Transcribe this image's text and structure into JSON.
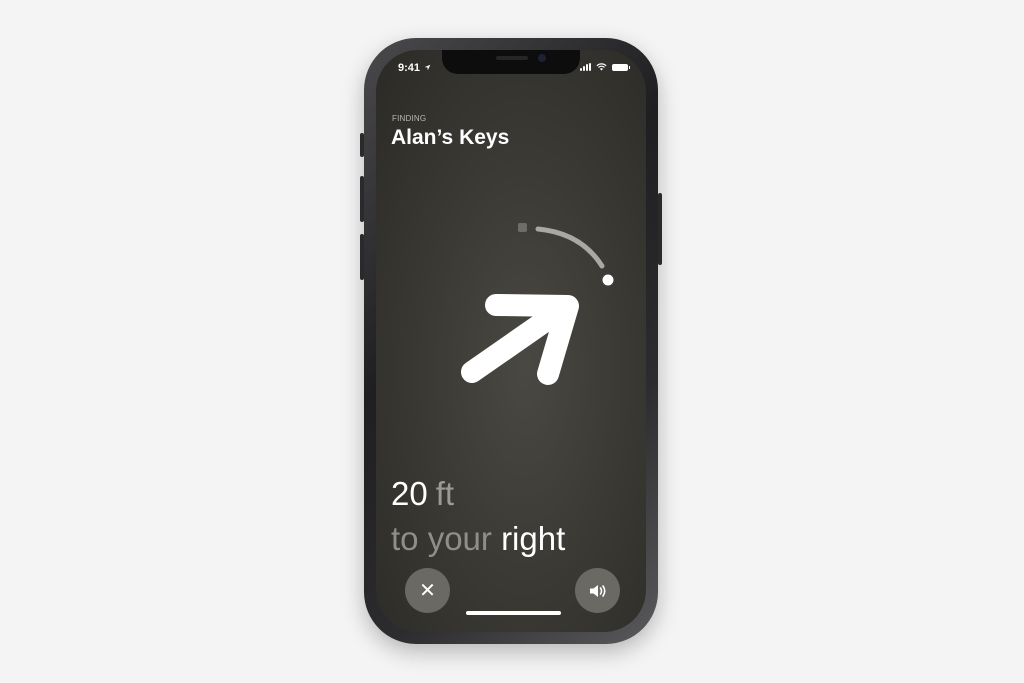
{
  "status_bar": {
    "time": "9:41"
  },
  "header": {
    "finding_label": "FINDING",
    "title": "Alan’s Keys"
  },
  "distance": {
    "value": "20",
    "unit": "ft"
  },
  "direction": {
    "prefix": "to your",
    "word": "right"
  },
  "buttons": {
    "close_icon": "✕"
  },
  "colors": {
    "background": "#3b3a35",
    "accent": "#ffffff",
    "muted": "#8f8e88"
  }
}
